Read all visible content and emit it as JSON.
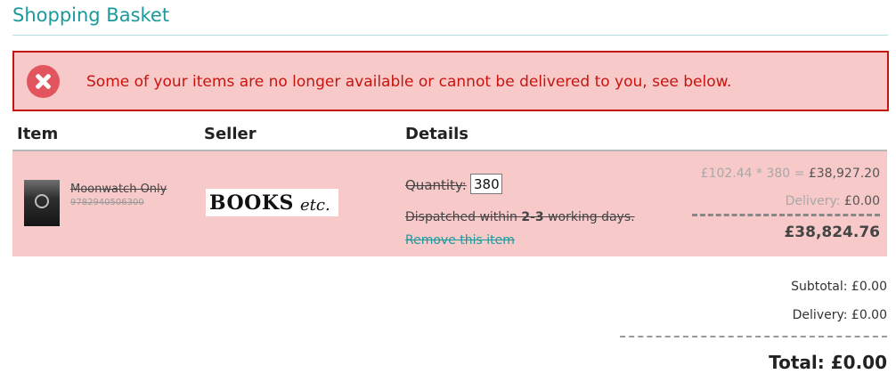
{
  "page": {
    "title": "Shopping Basket"
  },
  "alert": {
    "icon": "error-x-circle-icon",
    "message": "Some of your items are no longer available or cannot be delivered to you, see below."
  },
  "table": {
    "headers": {
      "item": "Item",
      "seller": "Seller",
      "details": "Details"
    }
  },
  "line_item": {
    "name": "Moonwatch Only",
    "isbn": "9782940506300",
    "seller_logo_main": "BOOKS",
    "seller_logo_sub": "etc.",
    "quantity_label": "Quantity:",
    "quantity": "380",
    "dispatch_prefix": "Dispatched within ",
    "dispatch_days": "2-3",
    "dispatch_suffix": " working days.",
    "remove_link": "Remove this item",
    "unit_price": "£102.44",
    "multiply": " * ",
    "qty_display": "380",
    "equals": " = ",
    "line_subtotal": "£38,927.20",
    "delivery_label": "Delivery: ",
    "delivery_value": "£0.00",
    "line_total": "£38,824.76"
  },
  "summary": {
    "subtotal_label": "Subtotal: ",
    "subtotal_value": "£0.00",
    "delivery_label": "Delivery: ",
    "delivery_value": "£0.00",
    "total_label": "Total: ",
    "total_value": "£0.00"
  },
  "colors": {
    "accent": "#1a9a9d",
    "error": "#c8140f",
    "error_background": "#f7c9c9",
    "error_icon": "#e2555e"
  }
}
